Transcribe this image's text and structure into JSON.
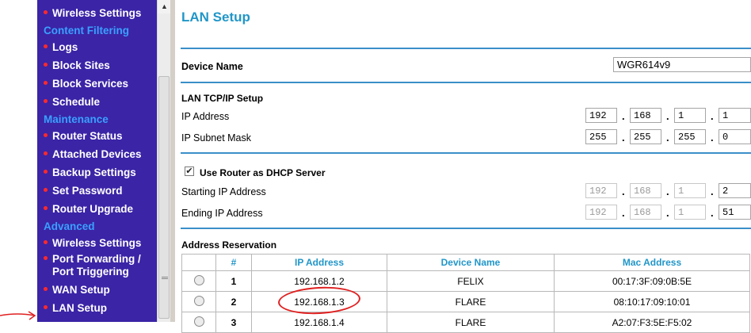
{
  "sidebar": {
    "items": [
      {
        "type": "item",
        "label": "Wireless Settings",
        "name": "sidebar-item-wireless-settings"
      },
      {
        "type": "header",
        "label": "Content Filtering",
        "name": "sidebar-header-content-filtering"
      },
      {
        "type": "item",
        "label": "Logs",
        "name": "sidebar-item-logs"
      },
      {
        "type": "item",
        "label": "Block Sites",
        "name": "sidebar-item-block-sites"
      },
      {
        "type": "item",
        "label": "Block Services",
        "name": "sidebar-item-block-services"
      },
      {
        "type": "item",
        "label": "Schedule",
        "name": "sidebar-item-schedule"
      },
      {
        "type": "header",
        "label": "Maintenance",
        "name": "sidebar-header-maintenance"
      },
      {
        "type": "item",
        "label": "Router Status",
        "name": "sidebar-item-router-status"
      },
      {
        "type": "item",
        "label": "Attached Devices",
        "name": "sidebar-item-attached-devices"
      },
      {
        "type": "item",
        "label": "Backup Settings",
        "name": "sidebar-item-backup-settings"
      },
      {
        "type": "item",
        "label": "Set Password",
        "name": "sidebar-item-set-password"
      },
      {
        "type": "item",
        "label": "Router Upgrade",
        "name": "sidebar-item-router-upgrade"
      },
      {
        "type": "header",
        "label": "Advanced",
        "name": "sidebar-header-advanced"
      },
      {
        "type": "item",
        "label": "Wireless Settings",
        "name": "sidebar-item-advanced-wireless-settings"
      },
      {
        "type": "item",
        "label": "Port Forwarding /",
        "label2": "Port Triggering",
        "name": "sidebar-item-port-forwarding"
      },
      {
        "type": "item",
        "label": "WAN Setup",
        "name": "sidebar-item-wan-setup"
      },
      {
        "type": "item",
        "label": "LAN Setup",
        "name": "sidebar-item-lan-setup"
      }
    ]
  },
  "page": {
    "title": "LAN Setup"
  },
  "device": {
    "label": "Device Name",
    "value": "WGR614v9"
  },
  "tcpip": {
    "section": "LAN TCP/IP Setup",
    "ip_label": "IP Address",
    "ip": [
      "192",
      "168",
      "1",
      "1"
    ],
    "mask_label": "IP Subnet Mask",
    "mask": [
      "255",
      "255",
      "255",
      "0"
    ]
  },
  "dhcp": {
    "checkbox_label": "Use Router as DHCP Server",
    "checked": true,
    "start_label": "Starting IP Address",
    "start": [
      "192",
      "168",
      "1",
      "2"
    ],
    "end_label": "Ending IP Address",
    "end": [
      "192",
      "168",
      "1",
      "51"
    ]
  },
  "reservation": {
    "section": "Address Reservation",
    "columns": [
      "#",
      "IP Address",
      "Device Name",
      "Mac Address"
    ],
    "rows": [
      {
        "num": "1",
        "ip": "192.168.1.2",
        "device": "FELIX",
        "mac": "00:17:3F:09:0B:5E"
      },
      {
        "num": "2",
        "ip": "192.168.1.3",
        "device": "FLARE",
        "mac": "08:10:17:09:10:01"
      },
      {
        "num": "3",
        "ip": "192.168.1.4",
        "device": "FLARE",
        "mac": "A2:07:F3:5E:F5:02"
      }
    ]
  },
  "colors": {
    "sidebar_bg": "#3b24a6",
    "sidebar_header": "#3aa0ff",
    "accent": "#2196c8",
    "annotation": "#e02020"
  }
}
